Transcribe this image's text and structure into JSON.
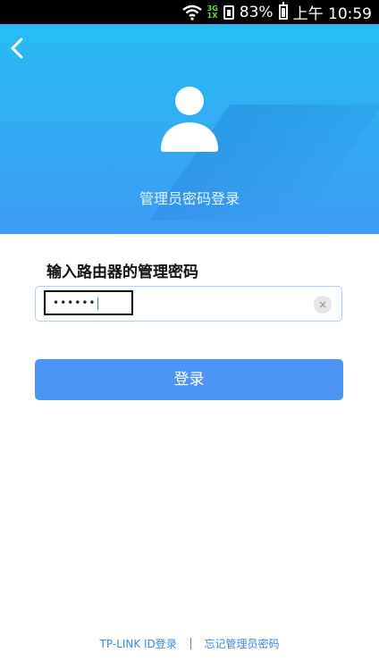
{
  "status_bar": {
    "network_top": "3G",
    "network_bottom": "1X",
    "battery": "83%",
    "time": "上午 10:59"
  },
  "header": {
    "back_icon": "chevron-left-icon",
    "avatar_icon": "user-icon",
    "title": "管理员密码登录",
    "gradient_top": "#27bdf4",
    "gradient_bottom": "#3d9cf5"
  },
  "form": {
    "label": "输入路由器的管理密码",
    "password_value": "••••••",
    "clear_icon": "×",
    "submit_label": "登录",
    "button_color": "#4d95f4"
  },
  "footer": {
    "link_tplink": "TP-LINK ID登录",
    "link_forgot": "忘记管理员密码"
  }
}
